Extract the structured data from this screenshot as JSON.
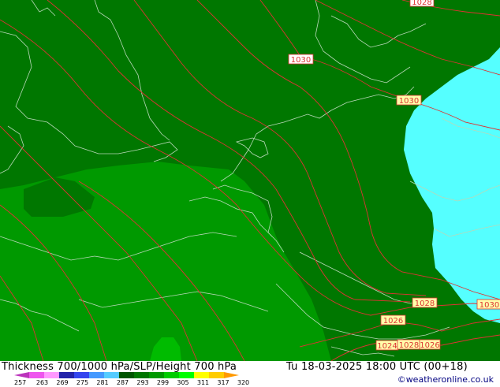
{
  "map": {
    "isobar_labels": [
      {
        "text": "1028",
        "id": "top-right"
      },
      {
        "text": "1030",
        "id": "north-sea"
      },
      {
        "text": "1030",
        "id": "denmark"
      },
      {
        "text": "1028",
        "id": "south-east"
      },
      {
        "text": "1026",
        "id": "alps"
      },
      {
        "text": "1030",
        "id": "east-edge"
      },
      {
        "text": "1024",
        "id": "south-a"
      },
      {
        "text": "1028",
        "id": "south-b"
      },
      {
        "text": "1026",
        "id": "south-c"
      }
    ],
    "colors": {
      "dark_green": "#007700",
      "mid_green": "#009900",
      "light_green": "#00bb00",
      "cyan": "#55ffff",
      "isobar": "#dd3333",
      "coast": "#b8d8b8"
    }
  },
  "footer": {
    "title": "Thickness 700/1000 hPa/SLP/Height 700 hPa",
    "datetime": "Tu 18-03-2025 18:00 UTC (00+18)",
    "credit": "©weatheronline.co.uk",
    "legend_colors": [
      "#bb33bb",
      "#ee55ee",
      "#ff99ff",
      "#2222aa",
      "#3344ee",
      "#4499ff",
      "#55ccff",
      "#005500",
      "#007700",
      "#009900",
      "#00cc00",
      "#00ff00",
      "#ffff00",
      "#ffcc00",
      "#ff9900"
    ],
    "legend_ticks": [
      "257",
      "263",
      "269",
      "275",
      "281",
      "287",
      "293",
      "299",
      "305",
      "311",
      "317",
      "320"
    ]
  }
}
